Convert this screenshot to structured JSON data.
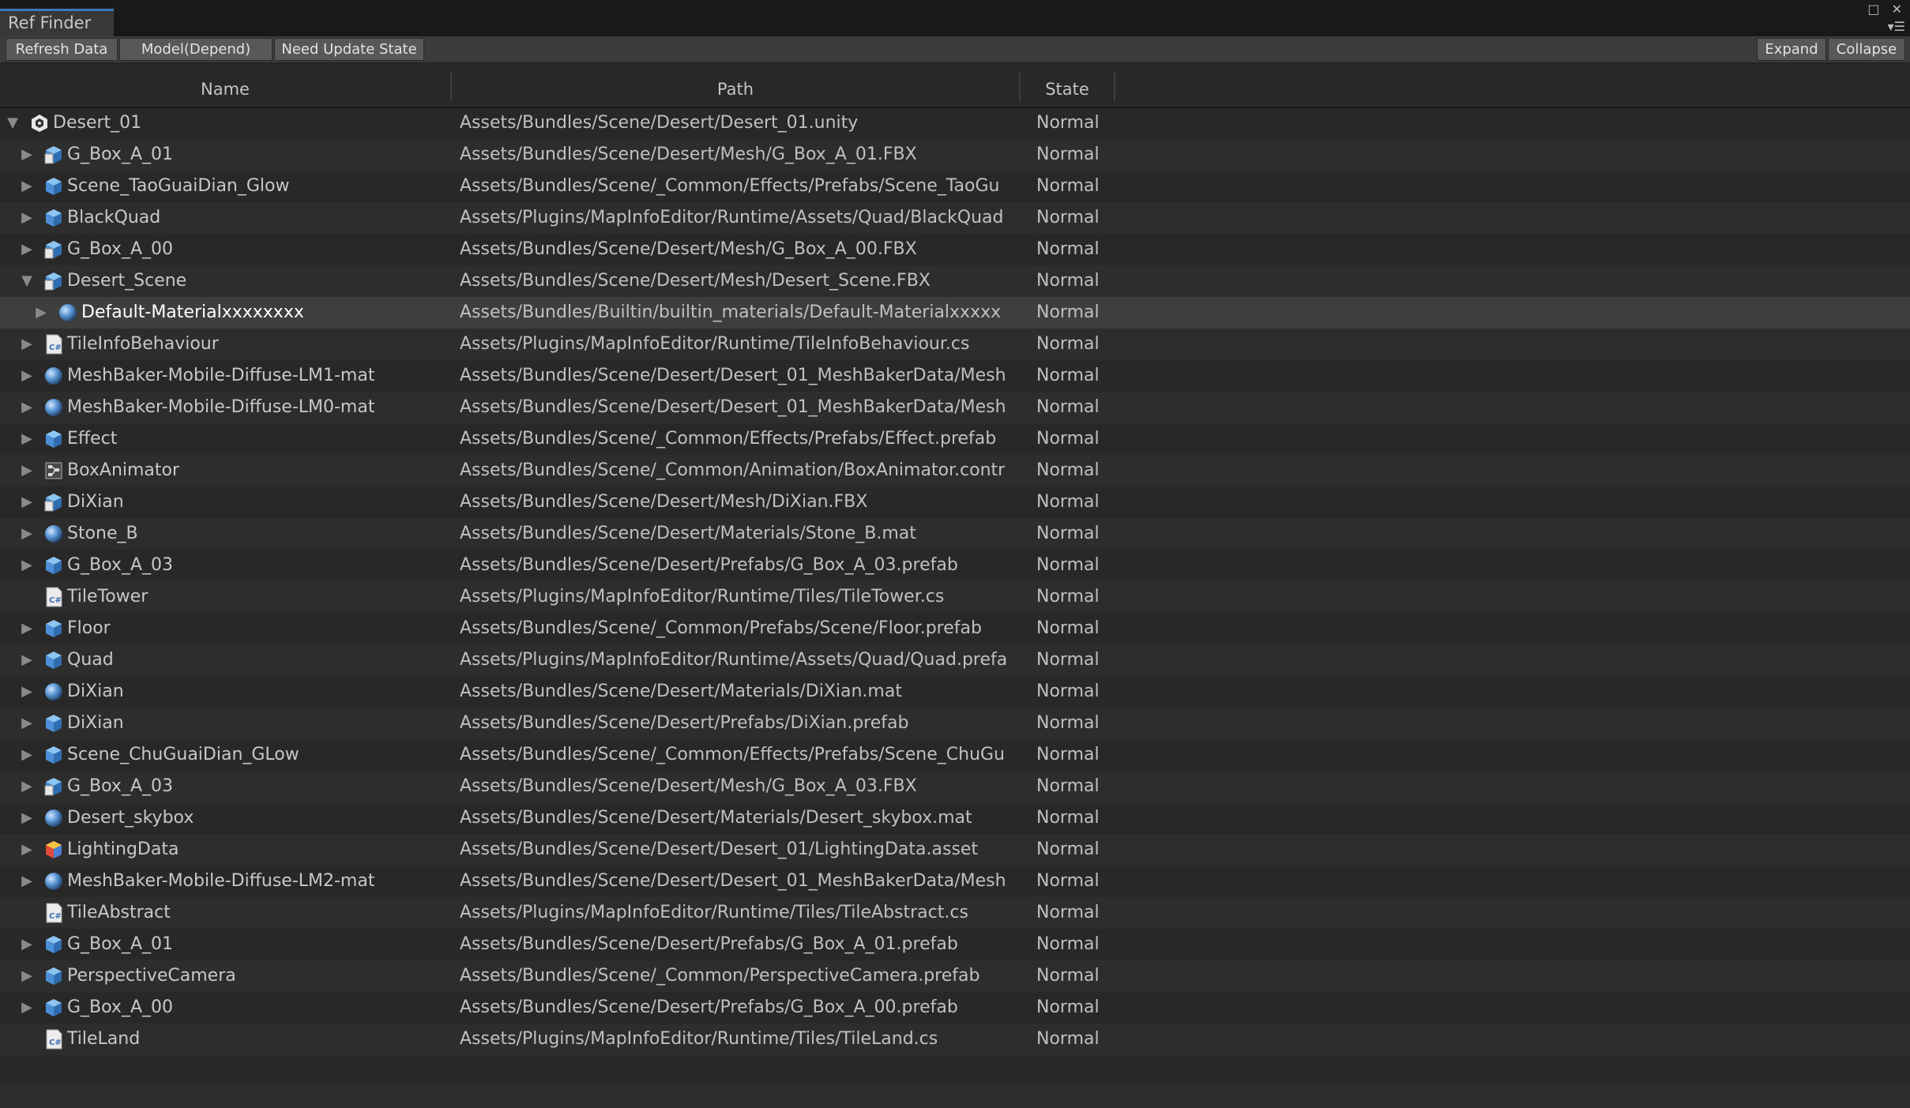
{
  "window": {
    "tab_title": "Ref Finder",
    "icons": [
      "maximize-icon",
      "close-icon",
      "window-menu-icon"
    ]
  },
  "toolbar": {
    "refresh_label": "Refresh Data",
    "mode_label": "Model(Depend)",
    "update_label": "Need Update State",
    "expand_label": "Expand",
    "collapse_label": "Collapse"
  },
  "columns": {
    "name": "Name",
    "path": "Path",
    "state": "State"
  },
  "rows": [
    {
      "depth": 0,
      "expanded": true,
      "has_children": true,
      "icon": "unity-scene-icon",
      "name": "Desert_01",
      "path": "Assets/Bundles/Scene/Desert/Desert_01.unity",
      "state": "Normal"
    },
    {
      "depth": 1,
      "expanded": false,
      "has_children": true,
      "icon": "model-icon",
      "name": "G_Box_A_01",
      "path": "Assets/Bundles/Scene/Desert/Mesh/G_Box_A_01.FBX",
      "state": "Normal"
    },
    {
      "depth": 1,
      "expanded": false,
      "has_children": true,
      "icon": "prefab-icon",
      "name": "Scene_TaoGuaiDian_Glow",
      "path": "Assets/Bundles/Scene/_Common/Effects/Prefabs/Scene_TaoGu",
      "state": "Normal"
    },
    {
      "depth": 1,
      "expanded": false,
      "has_children": true,
      "icon": "prefab-icon",
      "name": "BlackQuad",
      "path": "Assets/Plugins/MapInfoEditor/Runtime/Assets/Quad/BlackQuad",
      "state": "Normal"
    },
    {
      "depth": 1,
      "expanded": false,
      "has_children": true,
      "icon": "model-icon",
      "name": "G_Box_A_00",
      "path": "Assets/Bundles/Scene/Desert/Mesh/G_Box_A_00.FBX",
      "state": "Normal"
    },
    {
      "depth": 1,
      "expanded": true,
      "has_children": true,
      "icon": "model-icon",
      "name": "Desert_Scene",
      "path": "Assets/Bundles/Scene/Desert/Mesh/Desert_Scene.FBX",
      "state": "Normal"
    },
    {
      "depth": 2,
      "expanded": false,
      "has_children": true,
      "icon": "material-icon",
      "name": "Default-Materialxxxxxxxx",
      "path": "Assets/Bundles/Builtin/builtin_materials/Default-Materialxxxxx",
      "state": "Normal",
      "selected": true
    },
    {
      "depth": 1,
      "expanded": false,
      "has_children": true,
      "icon": "csharp-script-icon",
      "name": "TileInfoBehaviour",
      "path": "Assets/Plugins/MapInfoEditor/Runtime/TileInfoBehaviour.cs",
      "state": "Normal"
    },
    {
      "depth": 1,
      "expanded": false,
      "has_children": true,
      "icon": "material-icon",
      "name": "MeshBaker-Mobile-Diffuse-LM1-mat",
      "path": "Assets/Bundles/Scene/Desert/Desert_01_MeshBakerData/Mesh",
      "state": "Normal"
    },
    {
      "depth": 1,
      "expanded": false,
      "has_children": true,
      "icon": "material-icon",
      "name": "MeshBaker-Mobile-Diffuse-LM0-mat",
      "path": "Assets/Bundles/Scene/Desert/Desert_01_MeshBakerData/Mesh",
      "state": "Normal"
    },
    {
      "depth": 1,
      "expanded": false,
      "has_children": true,
      "icon": "prefab-icon",
      "name": "Effect",
      "path": "Assets/Bundles/Scene/_Common/Effects/Prefabs/Effect.prefab",
      "state": "Normal"
    },
    {
      "depth": 1,
      "expanded": false,
      "has_children": true,
      "icon": "animator-controller-icon",
      "name": "BoxAnimator",
      "path": "Assets/Bundles/Scene/_Common/Animation/BoxAnimator.contr",
      "state": "Normal"
    },
    {
      "depth": 1,
      "expanded": false,
      "has_children": true,
      "icon": "model-icon",
      "name": "DiXian",
      "path": "Assets/Bundles/Scene/Desert/Mesh/DiXian.FBX",
      "state": "Normal"
    },
    {
      "depth": 1,
      "expanded": false,
      "has_children": true,
      "icon": "material-icon",
      "name": "Stone_B",
      "path": "Assets/Bundles/Scene/Desert/Materials/Stone_B.mat",
      "state": "Normal"
    },
    {
      "depth": 1,
      "expanded": false,
      "has_children": true,
      "icon": "prefab-icon",
      "name": "G_Box_A_03",
      "path": "Assets/Bundles/Scene/Desert/Prefabs/G_Box_A_03.prefab",
      "state": "Normal"
    },
    {
      "depth": 1,
      "expanded": false,
      "has_children": false,
      "icon": "csharp-script-icon",
      "name": "TileTower",
      "path": "Assets/Plugins/MapInfoEditor/Runtime/Tiles/TileTower.cs",
      "state": "Normal"
    },
    {
      "depth": 1,
      "expanded": false,
      "has_children": true,
      "icon": "prefab-icon",
      "name": "Floor",
      "path": "Assets/Bundles/Scene/_Common/Prefabs/Scene/Floor.prefab",
      "state": "Normal"
    },
    {
      "depth": 1,
      "expanded": false,
      "has_children": true,
      "icon": "prefab-icon",
      "name": "Quad",
      "path": "Assets/Plugins/MapInfoEditor/Runtime/Assets/Quad/Quad.prefa",
      "state": "Normal"
    },
    {
      "depth": 1,
      "expanded": false,
      "has_children": true,
      "icon": "material-icon",
      "name": "DiXian",
      "path": "Assets/Bundles/Scene/Desert/Materials/DiXian.mat",
      "state": "Normal"
    },
    {
      "depth": 1,
      "expanded": false,
      "has_children": true,
      "icon": "prefab-icon",
      "name": "DiXian",
      "path": "Assets/Bundles/Scene/Desert/Prefabs/DiXian.prefab",
      "state": "Normal"
    },
    {
      "depth": 1,
      "expanded": false,
      "has_children": true,
      "icon": "prefab-icon",
      "name": "Scene_ChuGuaiDian_GLow",
      "path": "Assets/Bundles/Scene/_Common/Effects/Prefabs/Scene_ChuGu",
      "state": "Normal"
    },
    {
      "depth": 1,
      "expanded": false,
      "has_children": true,
      "icon": "model-icon",
      "name": "G_Box_A_03",
      "path": "Assets/Bundles/Scene/Desert/Mesh/G_Box_A_03.FBX",
      "state": "Normal"
    },
    {
      "depth": 1,
      "expanded": false,
      "has_children": true,
      "icon": "material-icon",
      "name": "Desert_skybox",
      "path": "Assets/Bundles/Scene/Desert/Materials/Desert_skybox.mat",
      "state": "Normal"
    },
    {
      "depth": 1,
      "expanded": false,
      "has_children": true,
      "icon": "lighting-data-icon",
      "name": "LightingData",
      "path": "Assets/Bundles/Scene/Desert/Desert_01/LightingData.asset",
      "state": "Normal"
    },
    {
      "depth": 1,
      "expanded": false,
      "has_children": true,
      "icon": "material-icon",
      "name": "MeshBaker-Mobile-Diffuse-LM2-mat",
      "path": "Assets/Bundles/Scene/Desert/Desert_01_MeshBakerData/Mesh",
      "state": "Normal"
    },
    {
      "depth": 1,
      "expanded": false,
      "has_children": false,
      "icon": "csharp-script-icon",
      "name": "TileAbstract",
      "path": "Assets/Plugins/MapInfoEditor/Runtime/Tiles/TileAbstract.cs",
      "state": "Normal"
    },
    {
      "depth": 1,
      "expanded": false,
      "has_children": true,
      "icon": "prefab-icon",
      "name": "G_Box_A_01",
      "path": "Assets/Bundles/Scene/Desert/Prefabs/G_Box_A_01.prefab",
      "state": "Normal"
    },
    {
      "depth": 1,
      "expanded": false,
      "has_children": true,
      "icon": "prefab-icon",
      "name": "PerspectiveCamera",
      "path": "Assets/Bundles/Scene/_Common/PerspectiveCamera.prefab",
      "state": "Normal"
    },
    {
      "depth": 1,
      "expanded": false,
      "has_children": true,
      "icon": "prefab-icon",
      "name": "G_Box_A_00",
      "path": "Assets/Bundles/Scene/Desert/Prefabs/G_Box_A_00.prefab",
      "state": "Normal"
    },
    {
      "depth": 1,
      "expanded": false,
      "has_children": false,
      "icon": "csharp-script-icon",
      "name": "TileLand",
      "path": "Assets/Plugins/MapInfoEditor/Runtime/Tiles/TileLand.cs",
      "state": "Normal"
    }
  ],
  "colors": {
    "background": "#282828",
    "titlebar": "#191919",
    "tab_accent": "#3a79bb",
    "row_alt": "#2d2d2d",
    "row_selected": "#3e3e3e",
    "icon_blue": "#4d8fd6"
  }
}
